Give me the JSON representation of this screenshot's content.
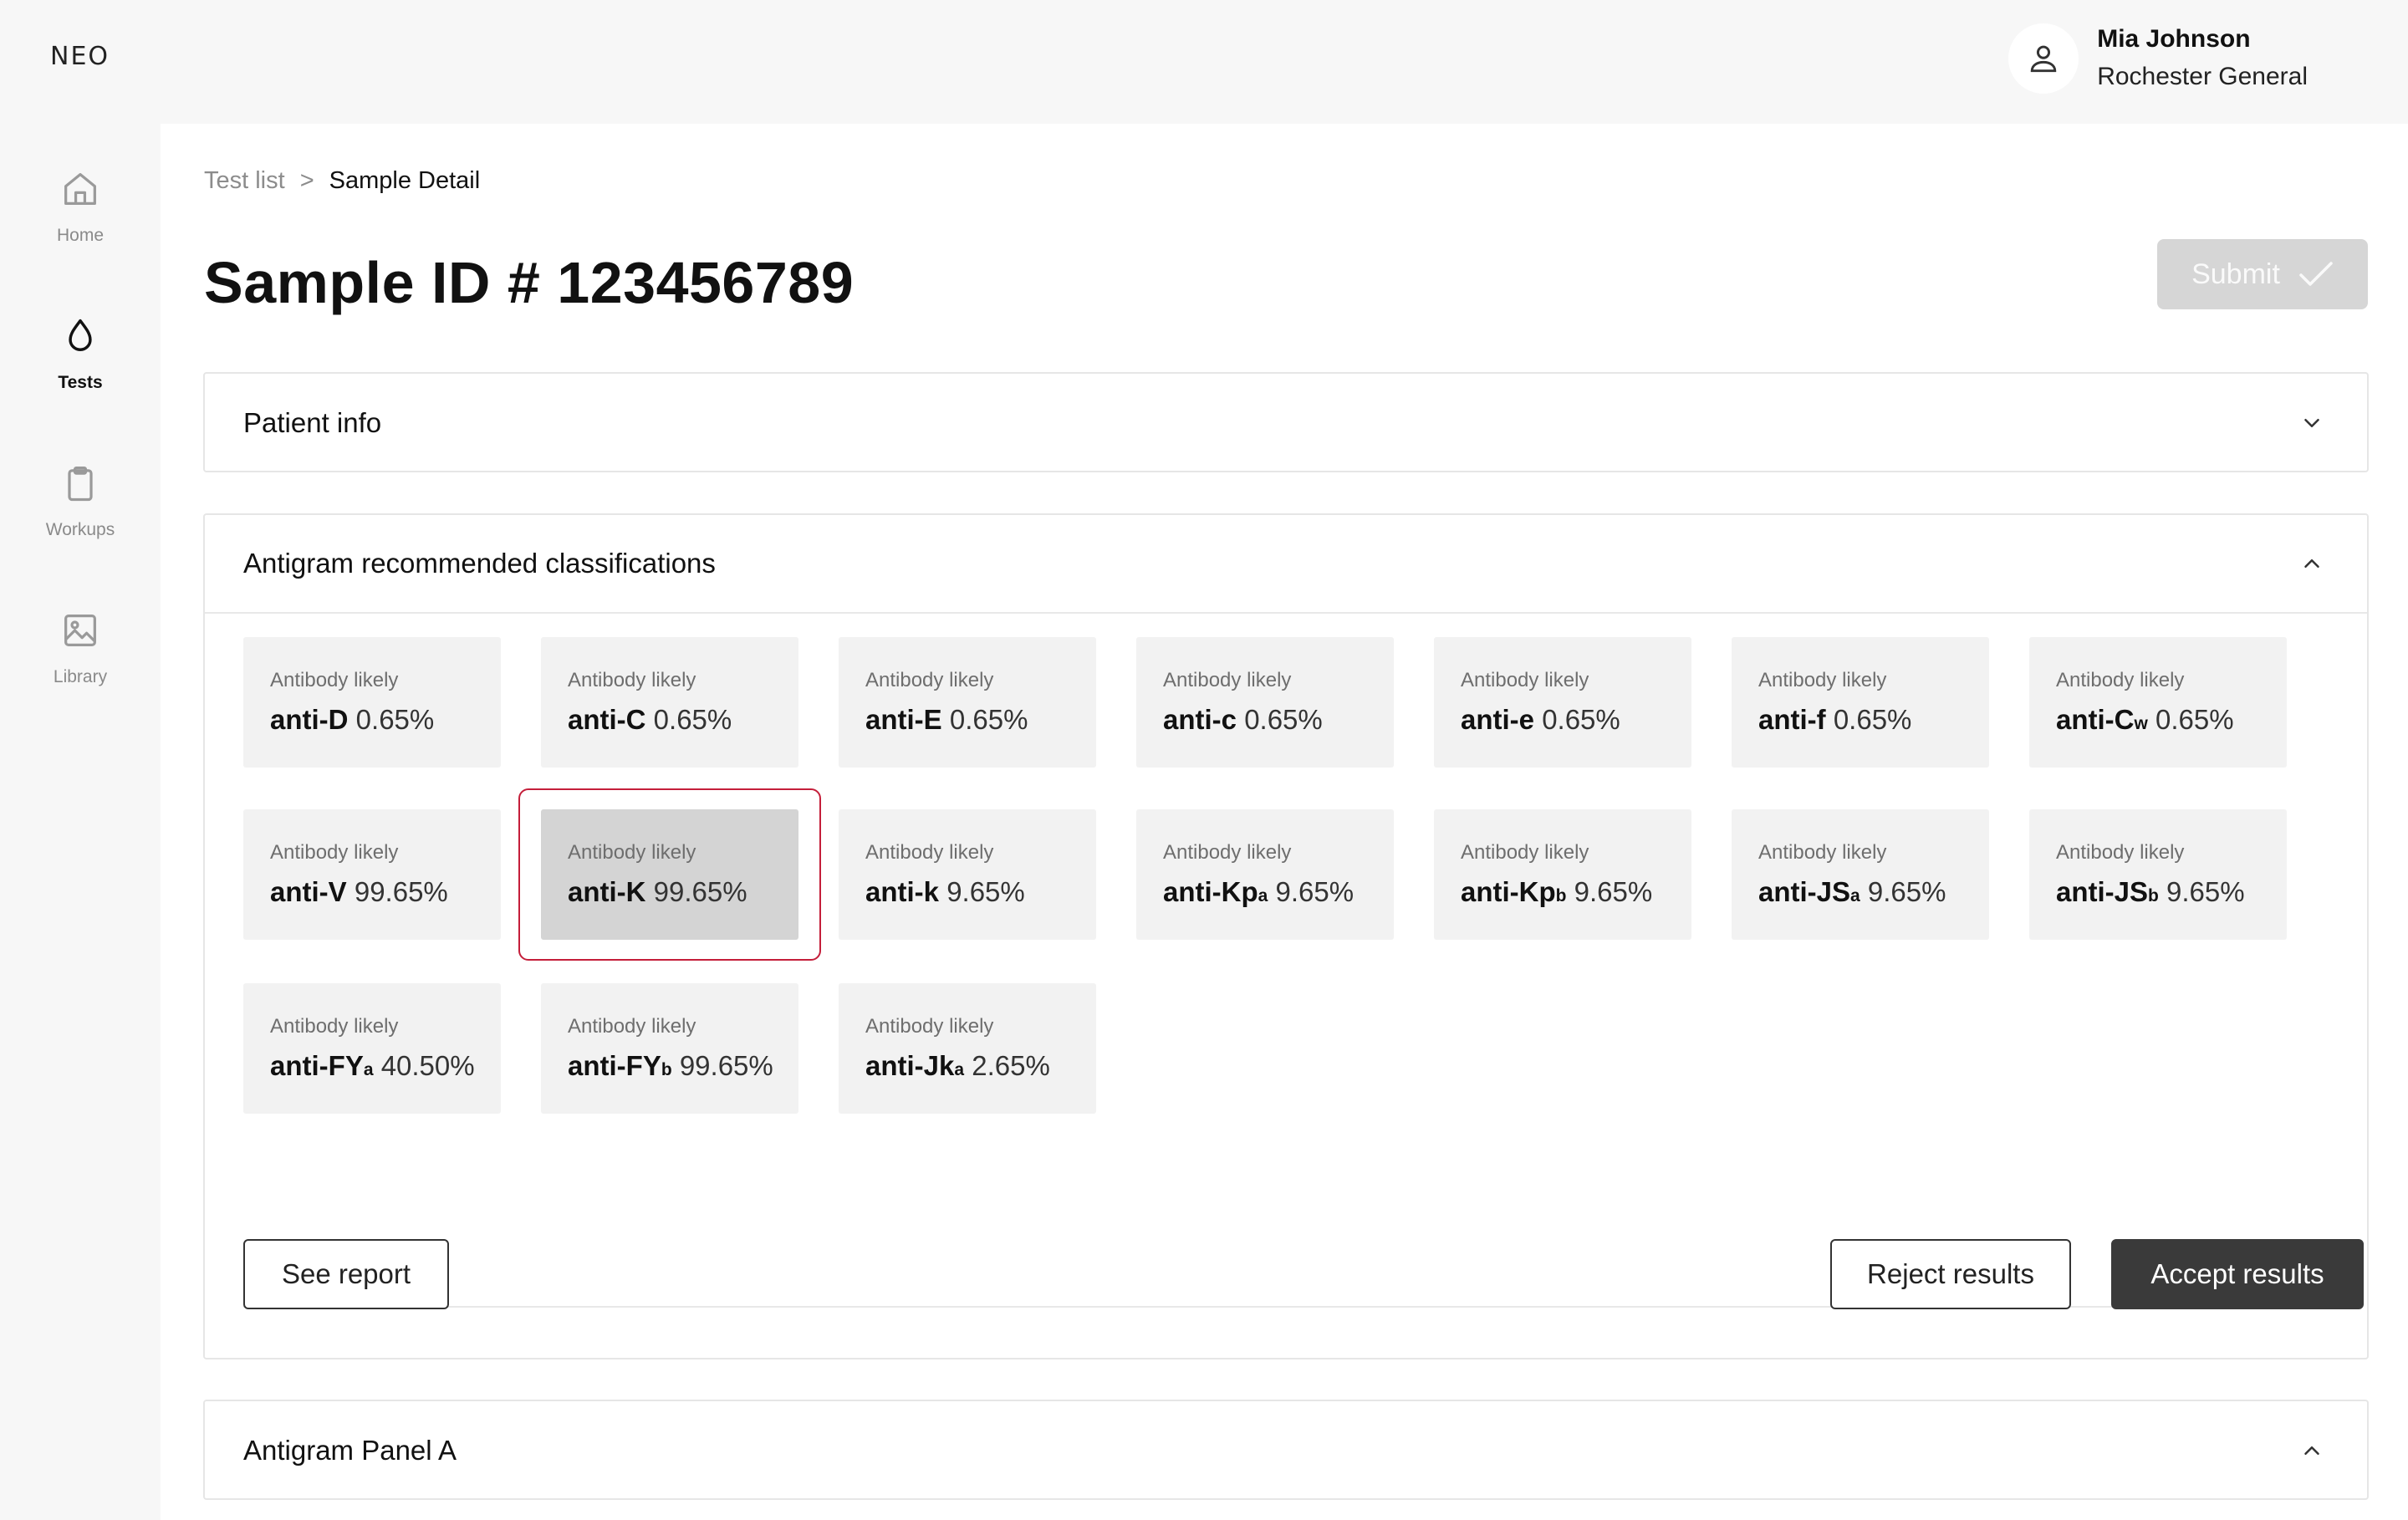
{
  "app": {
    "logo": "NEO"
  },
  "user": {
    "name": "Mia Johnson",
    "organization": "Rochester General",
    "avatar_icon": "user-icon"
  },
  "sidebar": {
    "items": [
      {
        "label": "Home",
        "icon": "home-icon",
        "active": false
      },
      {
        "label": "Tests",
        "icon": "droplet-icon",
        "active": true
      },
      {
        "label": "Workups",
        "icon": "clipboard-icon",
        "active": false
      },
      {
        "label": "Library",
        "icon": "image-icon",
        "active": false
      }
    ]
  },
  "breadcrumb": {
    "parent": "Test list",
    "separator": ">",
    "current": "Sample Detail"
  },
  "page": {
    "title": "Sample ID # 123456789"
  },
  "actions": {
    "submit_label": "Submit",
    "submit_icon": "check-icon",
    "submit_disabled": true
  },
  "sections": {
    "patient_info": {
      "title": "Patient info",
      "expanded": false
    },
    "classifications": {
      "title": "Antigram recommended classifications",
      "expanded": true
    },
    "panel_a": {
      "title": "Antigram Panel A",
      "expanded": true
    }
  },
  "classifications": {
    "tiles": [
      {
        "label": "Antibody likely",
        "name": "anti-D",
        "sub": "",
        "percent": "0.65%"
      },
      {
        "label": "Antibody likely",
        "name": "anti-C",
        "sub": "",
        "percent": "0.65%"
      },
      {
        "label": "Antibody likely",
        "name": "anti-E",
        "sub": "",
        "percent": "0.65%"
      },
      {
        "label": "Antibody likely",
        "name": "anti-c",
        "sub": "",
        "percent": "0.65%"
      },
      {
        "label": "Antibody likely",
        "name": "anti-e",
        "sub": "",
        "percent": "0.65%"
      },
      {
        "label": "Antibody likely",
        "name": "anti-f",
        "sub": "",
        "percent": "0.65%"
      },
      {
        "label": "Antibody likely",
        "name": "anti-C",
        "sub": "w",
        "percent": "0.65%"
      },
      {
        "label": "Antibody likely",
        "name": "anti-V",
        "sub": "",
        "percent": "99.65%"
      },
      {
        "label": "Antibody likely",
        "name": "anti-K",
        "sub": "",
        "percent": "99.65%"
      },
      {
        "label": "Antibody likely",
        "name": "anti-k",
        "sub": "",
        "percent": "9.65%"
      },
      {
        "label": "Antibody likely",
        "name": "anti-Kp",
        "sub": "a",
        "percent": "9.65%"
      },
      {
        "label": "Antibody likely",
        "name": "anti-Kp",
        "sub": "b",
        "percent": "9.65%"
      },
      {
        "label": "Antibody likely",
        "name": "anti-JS",
        "sub": "a",
        "percent": "9.65%"
      },
      {
        "label": "Antibody likely",
        "name": "anti-JS",
        "sub": "b",
        "percent": "9.65%"
      },
      {
        "label": "Antibody likely",
        "name": "anti-FY",
        "sub": "a",
        "percent": "40.50%"
      },
      {
        "label": "Antibody likely",
        "name": "anti-FY",
        "sub": "b",
        "percent": "99.65%"
      },
      {
        "label": "Antibody likely",
        "name": "anti-Jk",
        "sub": "a",
        "percent": "2.65%"
      }
    ],
    "selected_index": 8,
    "see_report_label": "See report",
    "reject_label": "Reject results",
    "accept_label": "Accept results"
  },
  "colors": {
    "selection_outline": "#c41e3a",
    "primary_dark": "#3a3a3a",
    "submit_disabled": "#d6d6d6"
  }
}
